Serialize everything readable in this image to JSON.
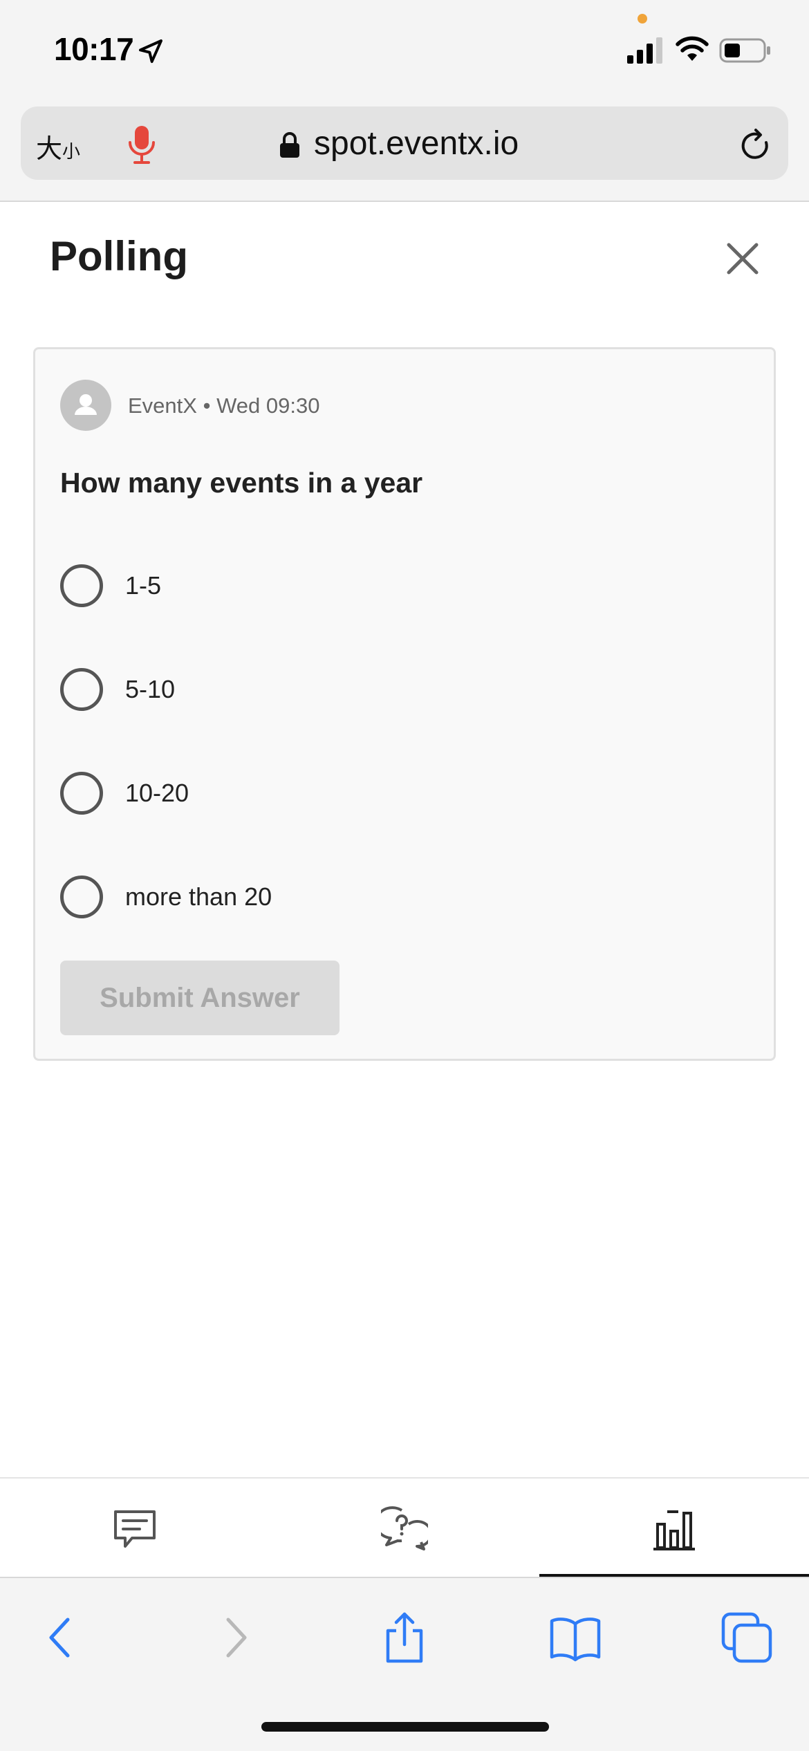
{
  "status_bar": {
    "time": "10:17"
  },
  "browser": {
    "text_size_large": "大",
    "text_size_small": "小",
    "url": "spot.eventx.io"
  },
  "page": {
    "title": "Polling"
  },
  "poll": {
    "author": "EventX",
    "separator": "•",
    "timestamp": "Wed 09:30",
    "question": "How many events in a year",
    "options": [
      {
        "label": "1-5"
      },
      {
        "label": "5-10"
      },
      {
        "label": "10-20"
      },
      {
        "label": "more than 20"
      }
    ],
    "submit_label": "Submit Answer"
  },
  "tabs": [
    {
      "icon": "chat-icon",
      "active": false
    },
    {
      "icon": "qa-icon",
      "active": false
    },
    {
      "icon": "poll-chart-icon",
      "active": true
    }
  ],
  "colors": {
    "accent_blue": "#2f7cf6",
    "mic_red": "#e5473c",
    "recording_dot": "#f0a43a",
    "submit_disabled_bg": "#dcdcdc",
    "submit_disabled_text": "#a8a8a8"
  }
}
